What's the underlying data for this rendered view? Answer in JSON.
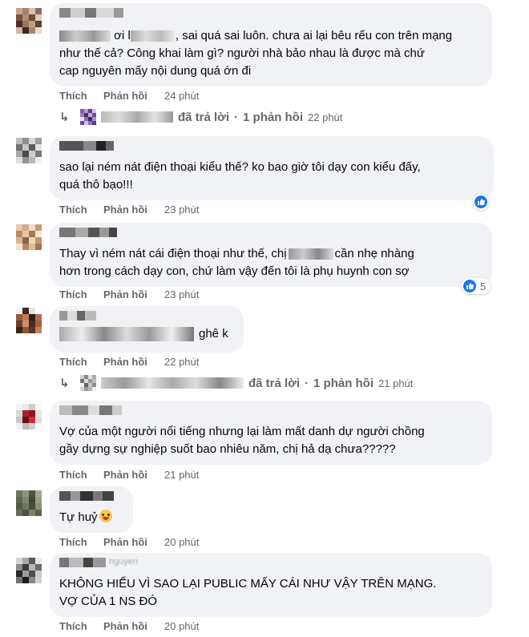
{
  "actions": {
    "like": "Thích",
    "reply": "Phản hồi"
  },
  "reply_summary_label": "đã trả lời",
  "reply_count_label": "1 phản hồi",
  "comments": [
    {
      "line1_pre": "ơi l",
      "line1_post": "sai quá sai luôn. chưa ai lại bêu rếu con trên mạng",
      "line2": "như thế cả? Công khai làm gì? người nhà bảo nhau là được mà chứ",
      "line3": "cap nguyên mấy nội dung quá ớn đi",
      "time": "24 phút",
      "reply_time": "22 phút"
    },
    {
      "line1": "sao lại ném nát điện thoại kiểu thế? ko bao giờ tôi dạy con kiểu đấy,",
      "line2": "quá thô bạo!!!",
      "time": "23 phút"
    },
    {
      "line1_pre": "Thay vì ném nát cái điện thoại như thế, chị",
      "line1_post": "cần nhẹ nhàng",
      "line2": "hơn trong cách dạy con, chứ làm vậy đến tôi là phụ huynh con sợ",
      "time": "23 phút",
      "reaction_count": "5"
    },
    {
      "line1_post": "ghê k",
      "time": "22 phút",
      "reply_time": "21 phút"
    },
    {
      "line1": "Vợ của một người nổi tiếng nhưng lại làm mất danh dự người chồng",
      "line2": "gầy dựng sự nghiệp suốt bao nhiêu năm, chị hả dạ chưa?????",
      "time": "21 phút"
    },
    {
      "line1": "Tự huỷ",
      "time": "20 phút"
    },
    {
      "name_partial": "nguyen",
      "line1": "KHÔNG HIỂU VÌ SAO LẠI PUBLIC MẤY CÁI NHƯ VẬY TRÊN MẠNG.",
      "line2": "VỢ CỦA 1 NS ĐÓ",
      "time": "20 phút"
    }
  ],
  "colors": {
    "bubble": "#f0f2f5",
    "meta": "#65676b",
    "text": "#050505",
    "like_blue": "#1877f2"
  }
}
